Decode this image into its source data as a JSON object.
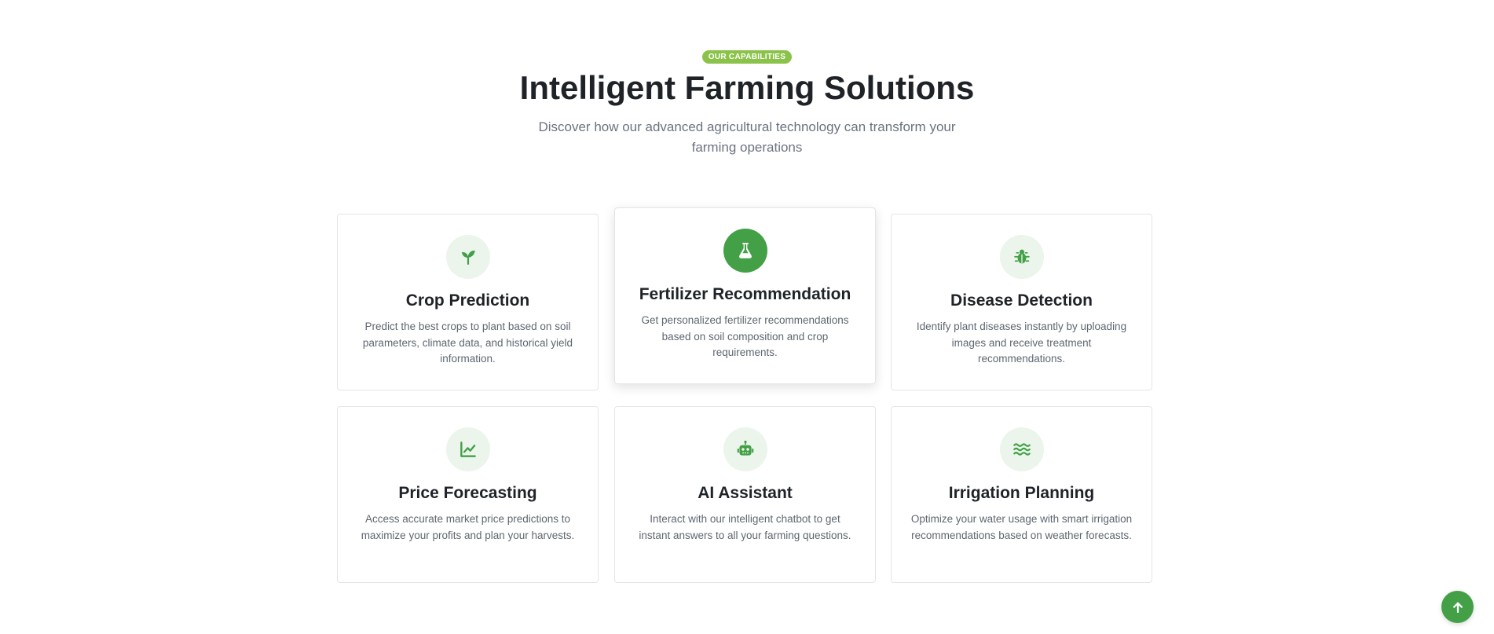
{
  "section": {
    "badge": "OUR CAPABILITIES",
    "title": "Intelligent Farming Solutions",
    "subtitle": "Discover how our advanced agricultural technology can transform your farming operations"
  },
  "colors": {
    "accent": "#43a047",
    "badge": "#8bc34a",
    "icon_background": "#ebf5ec"
  },
  "cards": [
    {
      "icon": "seedling-icon",
      "title": "Crop Prediction",
      "description": "Predict the best crops to plant based on soil parameters, climate data, and historical yield information."
    },
    {
      "icon": "flask-icon",
      "title": "Fertilizer Recommendation",
      "description": "Get personalized fertilizer recommendations based on soil composition and crop requirements."
    },
    {
      "icon": "bug-icon",
      "title": "Disease Detection",
      "description": "Identify plant diseases instantly by uploading images and receive treatment recommendations."
    },
    {
      "icon": "chart-line-icon",
      "title": "Price Forecasting",
      "description": "Access accurate market price predictions to maximize your profits and plan your harvests."
    },
    {
      "icon": "robot-icon",
      "title": "AI Assistant",
      "description": "Interact with our intelligent chatbot to get instant answers to all your farming questions."
    },
    {
      "icon": "water-icon",
      "title": "Irrigation Planning",
      "description": "Optimize your water usage with smart irrigation recommendations based on weather forecasts."
    }
  ],
  "back_to_top": {
    "icon": "arrow-up-icon"
  }
}
